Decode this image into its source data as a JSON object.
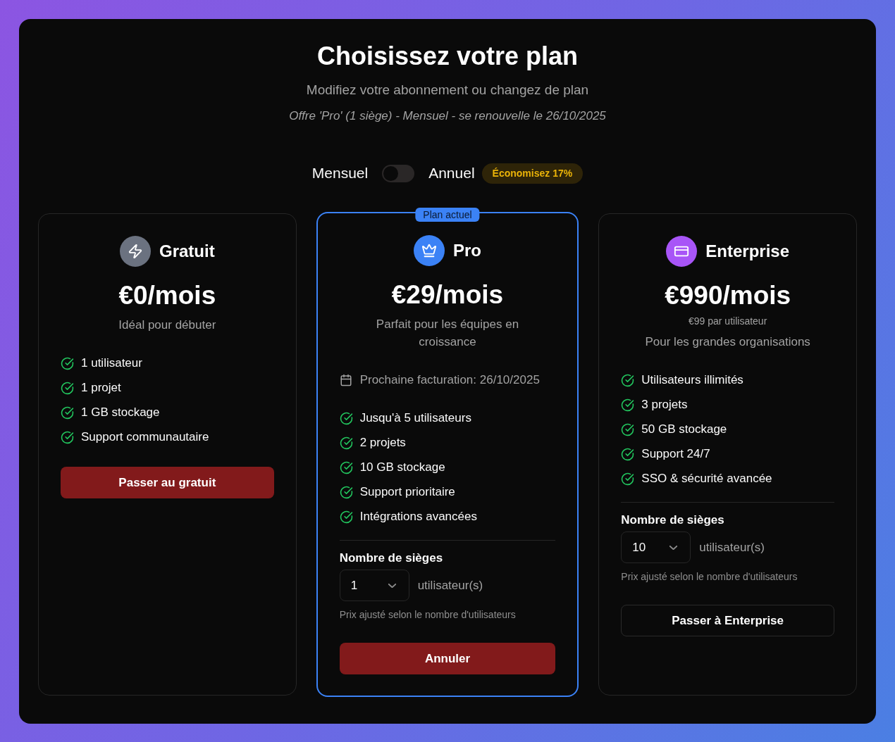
{
  "header": {
    "title": "Choisissez votre plan",
    "subtitle": "Modifiez votre abonnement ou changez de plan",
    "current_plan": "Offre 'Pro' (1 siège) - Mensuel - se renouvelle le 26/10/2025"
  },
  "billing": {
    "monthly_label": "Mensuel",
    "on": false,
    "annual_label": "Annuel",
    "savings_badge": "Économisez 17%"
  },
  "plans": [
    {
      "name": "Gratuit",
      "color": "#6b7280",
      "current": false,
      "price": "€0/mois",
      "description": "Idéal pour débuter",
      "features": [
        "1 utilisateur",
        "1 projet",
        "1 GB stockage",
        "Support communautaire"
      ],
      "button": {
        "label": "Passer au gratuit",
        "kind": "filled"
      }
    },
    {
      "name": "Pro",
      "color": "#3b82f6",
      "current": true,
      "badge": "Plan actuel",
      "price": "€29/mois",
      "description": "Parfait pour les équipes en croissance",
      "next_billing": "Prochaine facturation: 26/10/2025",
      "features": [
        "Jusqu'à 5 utilisateurs",
        "2 projets",
        "10 GB stockage",
        "Support prioritaire",
        "Intégrations avancées"
      ],
      "seats": {
        "label": "Nombre de sièges",
        "value": "1",
        "unit": "utilisateur(s)",
        "hint": "Prix ajusté selon le nombre d'utilisateurs"
      },
      "button": {
        "label": "Annuler",
        "kind": "filled"
      }
    },
    {
      "name": "Enterprise",
      "color": "#a855f7",
      "current": false,
      "price": "€990/mois",
      "per_user": "€99 par utilisateur",
      "description": "Pour les grandes organisations",
      "features": [
        "Utilisateurs illimités",
        "3 projets",
        "50 GB stockage",
        "Support 24/7",
        "SSO & sécurité avancée"
      ],
      "seats": {
        "label": "Nombre de sièges",
        "value": "10",
        "unit": "utilisateur(s)",
        "hint": "Prix ajusté selon le nombre d'utilisateurs"
      },
      "button": {
        "label": "Passer à Enterprise",
        "kind": "outline"
      }
    }
  ]
}
